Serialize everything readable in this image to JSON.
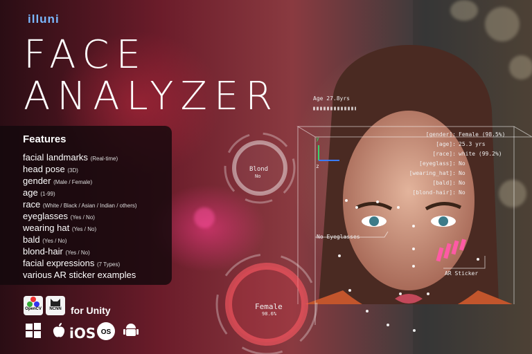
{
  "brand": "illuni",
  "title_line1": "FACE",
  "title_line2": "ANALYZER",
  "features": {
    "heading": "Features",
    "items": [
      {
        "label": "facial landmarks",
        "note": "(Real-time)"
      },
      {
        "label": "head pose",
        "note": "(3D)"
      },
      {
        "label": "gender",
        "note": "(Male / Female)"
      },
      {
        "label": "age",
        "note": "(1-99)"
      },
      {
        "label": "race",
        "note": "(White / Black / Asian / Indian / others)"
      },
      {
        "label": "eyeglasses",
        "note": "(Yes / No)"
      },
      {
        "label": "wearing hat",
        "note": "(Yes / No)"
      },
      {
        "label": "bald",
        "note": "(Yes / No)"
      },
      {
        "label": "blond-hair",
        "note": "(Yes / No)"
      },
      {
        "label": "facial expressions",
        "note": "(7 Types)"
      },
      {
        "label": "various AR sticker examples",
        "note": ""
      }
    ]
  },
  "badges": {
    "opencv": "OpenCV",
    "ncnn": "NCNN"
  },
  "for_unity": "for Unity",
  "platforms": {
    "ios": "iOS",
    "macos": "OS"
  },
  "hud": {
    "age_label": "Age 27.8yrs",
    "blond_label": "Blond",
    "blond_value": "No",
    "female_label": "Female",
    "female_value": "98.6%",
    "no_eyeglasses": "No Eyeglasses",
    "ar_sticker": "AR Sticker",
    "axis_y": "y",
    "axis_z": "z"
  },
  "attributes": [
    {
      "key": "[gender]:",
      "value": "Female (98.5%)"
    },
    {
      "key": "[age]:",
      "value": "25.3 yrs"
    },
    {
      "key": "[race]:",
      "value": "white (99.2%)"
    },
    {
      "key": "[eyeglass]:",
      "value": "No"
    },
    {
      "key": "[wearing_hat]:",
      "value": "No"
    },
    {
      "key": "[bald]:",
      "value": "No"
    },
    {
      "key": "[blond-hair]:",
      "value": "No"
    }
  ]
}
